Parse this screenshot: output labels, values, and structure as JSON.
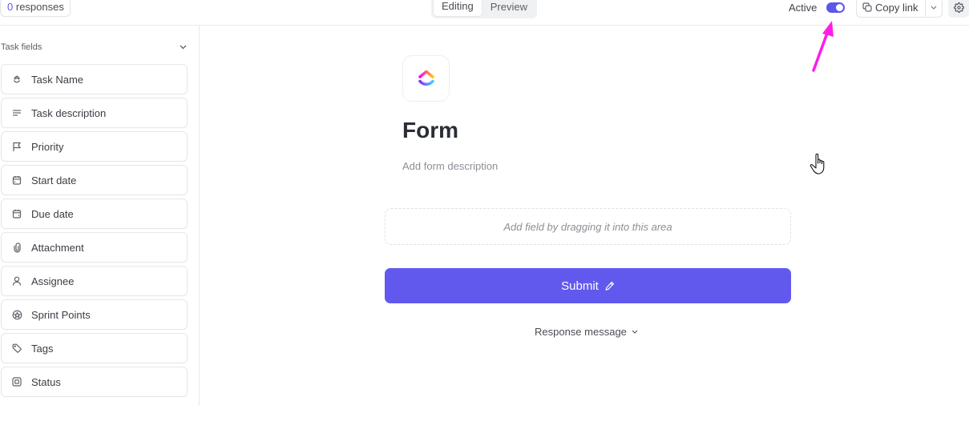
{
  "topbar": {
    "responses": {
      "count": "0",
      "label": "responses"
    },
    "mode_tabs": [
      {
        "label": "Editing",
        "active": true
      },
      {
        "label": "Preview",
        "active": false
      }
    ],
    "active_label": "Active",
    "active_toggle_on": true,
    "copy_link_label": "Copy link"
  },
  "sidebar": {
    "title": "Task fields",
    "fields": [
      {
        "label": "Task Name",
        "icon": "task-name-icon"
      },
      {
        "label": "Task description",
        "icon": "text-lines-icon"
      },
      {
        "label": "Priority",
        "icon": "flag-icon"
      },
      {
        "label": "Start date",
        "icon": "calendar-start-icon"
      },
      {
        "label": "Due date",
        "icon": "calendar-due-icon"
      },
      {
        "label": "Attachment",
        "icon": "paperclip-icon"
      },
      {
        "label": "Assignee",
        "icon": "user-icon"
      },
      {
        "label": "Sprint Points",
        "icon": "sprint-points-icon"
      },
      {
        "label": "Tags",
        "icon": "tag-icon"
      },
      {
        "label": "Status",
        "icon": "status-icon"
      }
    ]
  },
  "form": {
    "title": "Form",
    "description_placeholder": "Add form description",
    "dropzone_text": "Add field by dragging it into this area",
    "submit_label": "Submit",
    "response_message_label": "Response message"
  },
  "colors": {
    "accent": "#6159ee",
    "toggle": "#5b57e8",
    "annotation_arrow": "#ff1ee6"
  }
}
